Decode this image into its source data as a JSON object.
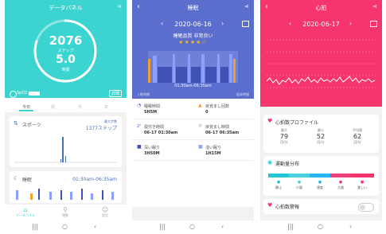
{
  "phone1": {
    "title": "データパネル",
    "steps": "2076",
    "steps_unit": "ステップ",
    "hours": "5.0",
    "hours_unit": "時間",
    "ring_progress": 0.8,
    "spo2_label": "SpO2",
    "detail_button": "詳細",
    "tabs": [
      "今日",
      "週",
      "月",
      "年"
    ],
    "sports_label": "スポーツ",
    "sports_value": "1377ステップ",
    "sports_max": "最大步数",
    "sleep_label": "睡眠",
    "sleep_range": "01:30am-06:35am",
    "nav": [
      "データパネル",
      "運動",
      "設定"
    ],
    "accent": "#3bd4d0"
  },
  "phone2": {
    "title": "睡眠",
    "date": "2020-06-16",
    "quality": "睡眠品質 非常良い",
    "stars": "★★★★☆",
    "time_range": "01:30am-06:35am",
    "timeline_left": "入眠時間",
    "timeline_right": "起床時間",
    "cells": [
      {
        "icon": "sleep-time-icon",
        "glyph": "◔",
        "label": "睡眠時間",
        "value": "5H5M",
        "color": "#5b6ecd"
      },
      {
        "icon": "wake-count-icon",
        "glyph": "▲",
        "label": "目覚まし回数",
        "value": "0",
        "color": "#f0a030"
      },
      {
        "icon": "bedtime-icon",
        "glyph": "zᶻ",
        "label": "寝付き時間",
        "value": "06-17 01:30am",
        "color": "#5b6ecd"
      },
      {
        "icon": "waketime-icon",
        "glyph": "☼",
        "label": "目覚まし時間",
        "value": "06-17 06:35am",
        "color": "#888"
      },
      {
        "icon": "deep-sleep-icon",
        "glyph": "■",
        "label": "深い眠り",
        "value": "3H50M",
        "color": "#3f51b5"
      },
      {
        "icon": "light-sleep-icon",
        "glyph": "■",
        "label": "浅い眠り",
        "value": "1H15M",
        "color": "#8c9eff"
      }
    ],
    "accent": "#5b6ecd"
  },
  "phone3": {
    "title": "心拍",
    "date": "2020-06-17",
    "profile_title": "心拍数プロファイル",
    "stats": [
      {
        "label": "最大",
        "value": "79",
        "unit": "回/分"
      },
      {
        "label": "最小",
        "value": "52",
        "unit": "回/分"
      },
      {
        "label": "平均値",
        "value": "62",
        "unit": "回/分"
      }
    ],
    "zones_title": "運動量分布",
    "zones": [
      "静止",
      "少量",
      "適度",
      "大量",
      "激しい"
    ],
    "zone_colors": [
      "#26c6da",
      "#4dd0e1",
      "#29b6f6",
      "#ec407a",
      "#f5356c"
    ],
    "warn_title": "心拍数警報",
    "accent": "#f5356c"
  }
}
